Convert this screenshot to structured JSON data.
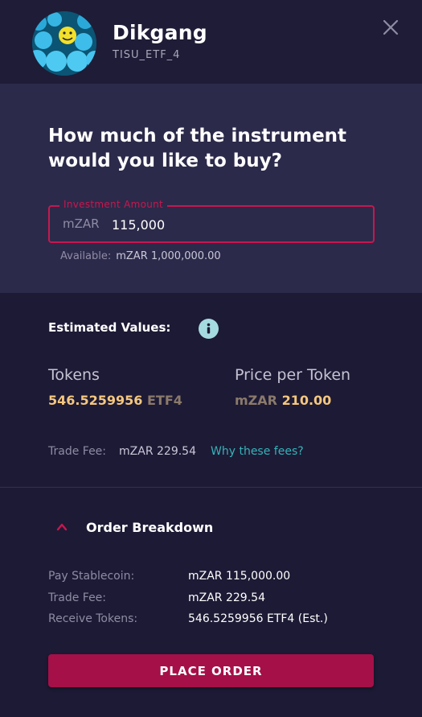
{
  "header": {
    "name": "Dikgang",
    "instrument": "TISU_ETF_4",
    "close_icon": "close-icon"
  },
  "buy": {
    "question": "How much of the instrument would you like to buy?",
    "amount_label": "Investment Amount",
    "currency": "mZAR",
    "amount_value": "115,000",
    "available_label": "Available:",
    "available_value": "mZAR 1,000,000.00"
  },
  "estimates": {
    "title": "Estimated Values:",
    "info_icon": "info-icon",
    "tokens_label": "Tokens",
    "tokens_value": "546.5259956",
    "tokens_unit": "ETF4",
    "price_label": "Price per Token",
    "price_currency": "mZAR",
    "price_value": "210.00",
    "fee_label": "Trade Fee:",
    "fee_value": "mZAR 229.54",
    "fee_link": "Why these fees?"
  },
  "breakdown": {
    "title": "Order Breakdown",
    "chevron_icon": "chevron-up-icon",
    "rows": [
      {
        "label": "Pay Stablecoin:",
        "value": "mZAR 115,000.00"
      },
      {
        "label": "Trade Fee:",
        "value": "mZAR 229.54"
      },
      {
        "label": "Receive Tokens:",
        "value": "546.5259956 ETF4 (Est.)"
      }
    ]
  },
  "action": {
    "place_order": "PLACE ORDER"
  },
  "colors": {
    "background": "#1d1a35",
    "panel": "#2c2a4a",
    "accent": "#c8174f",
    "button": "#a51048",
    "gold": "#f5c77e",
    "link": "#35b3b8"
  }
}
